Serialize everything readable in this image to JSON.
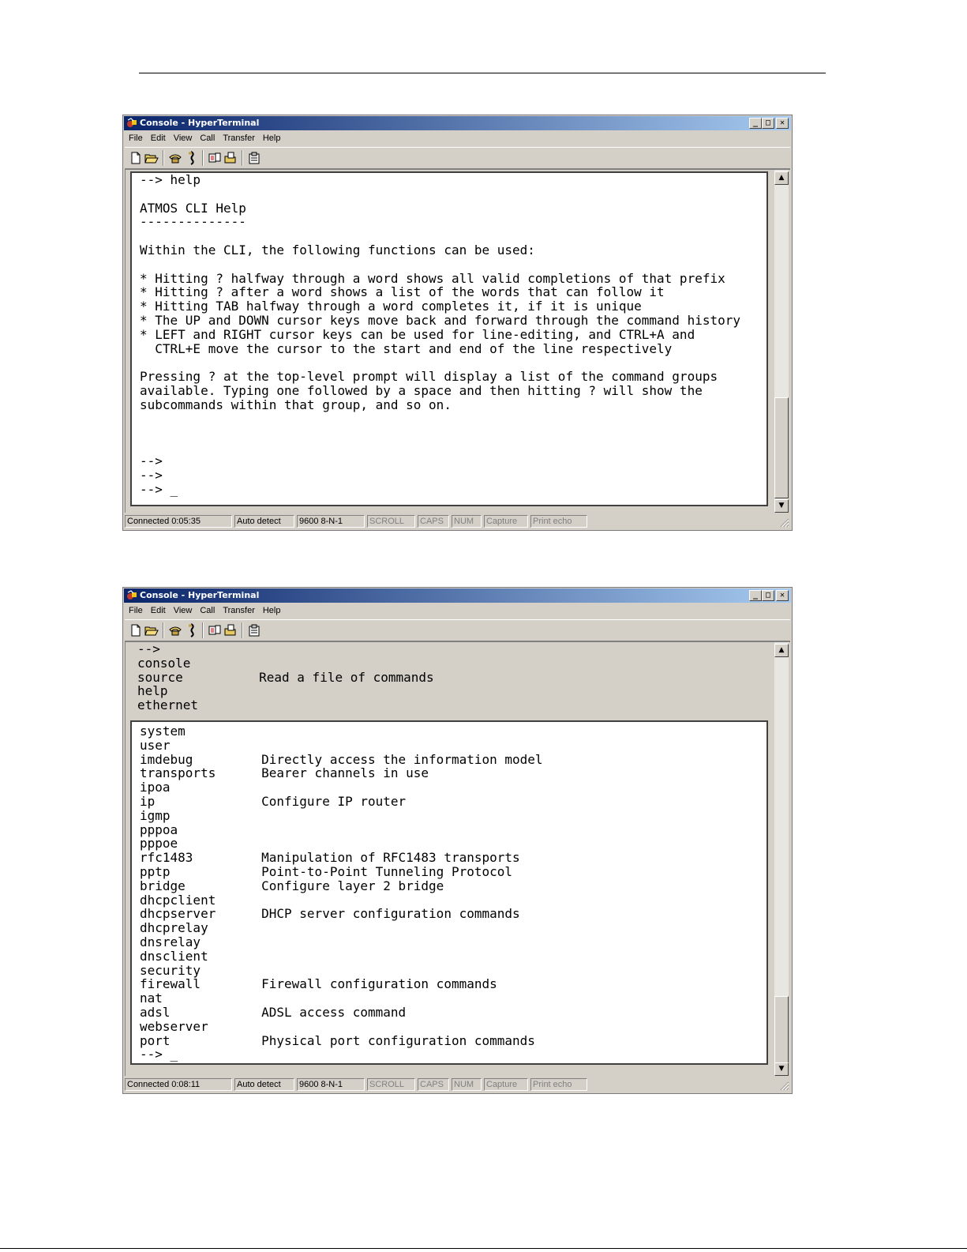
{
  "windows": [
    {
      "title": "Console - HyperTerminal",
      "menu": [
        "File",
        "Edit",
        "View",
        "Call",
        "Transfer",
        "Help"
      ],
      "toolbar_icons": [
        "new-document-icon",
        "open-folder-icon",
        "phone-connect-icon",
        "phone-disconnect-icon",
        "send-icon",
        "receive-icon",
        "properties-icon"
      ],
      "terminal_lines": [
        "--> help",
        "",
        "ATMOS CLI Help",
        "--------------",
        "",
        "Within the CLI, the following functions can be used:",
        "",
        "* Hitting ? halfway through a word shows all valid completions of that prefix",
        "* Hitting ? after a word shows a list of the words that can follow it",
        "* Hitting TAB halfway through a word completes it, if it is unique",
        "* The UP and DOWN cursor keys move back and forward through the command history",
        "* LEFT and RIGHT cursor keys can be used for line-editing, and CTRL+A and",
        "  CTRL+E move the cursor to the start and end of the line respectively",
        "",
        "Pressing ? at the top-level prompt will display a list of the command groups",
        "available. Typing one followed by a space and then hitting ? will show the",
        "subcommands within that group, and so on.",
        "",
        "",
        "",
        "-->",
        "-->",
        "--> _"
      ],
      "status": {
        "connected": "Connected 0:05:35",
        "detect": "Auto detect",
        "settings": "9600 8-N-1",
        "scroll": "SCROLL",
        "caps": "CAPS",
        "num": "NUM",
        "capture": "Capture",
        "print_echo": "Print echo"
      }
    },
    {
      "title": "Console - HyperTerminal",
      "menu": [
        "File",
        "Edit",
        "View",
        "Call",
        "Transfer",
        "Help"
      ],
      "toolbar_icons": [
        "new-document-icon",
        "open-folder-icon",
        "phone-connect-icon",
        "phone-disconnect-icon",
        "send-icon",
        "receive-icon",
        "properties-icon"
      ],
      "scrollback_lines": [
        "-->",
        "console",
        "source          Read a file of commands",
        "help",
        "ethernet"
      ],
      "terminal_lines": [
        "system",
        "user",
        "imdebug         Directly access the information model",
        "transports      Bearer channels in use",
        "ipoa",
        "ip              Configure IP router",
        "igmp",
        "pppoa",
        "pppoe",
        "rfc1483         Manipulation of RFC1483 transports",
        "pptp            Point-to-Point Tunneling Protocol",
        "bridge          Configure layer 2 bridge",
        "dhcpclient",
        "dhcpserver      DHCP server configuration commands",
        "dhcprelay",
        "dnsrelay",
        "dnsclient",
        "security",
        "firewall        Firewall configuration commands",
        "nat",
        "adsl            ADSL access command",
        "webserver",
        "port            Physical port configuration commands",
        "--> _"
      ],
      "status": {
        "connected": "Connected 0:08:11",
        "detect": "Auto detect",
        "settings": "9600 8-N-1",
        "scroll": "SCROLL",
        "caps": "CAPS",
        "num": "NUM",
        "capture": "Capture",
        "print_echo": "Print echo"
      }
    }
  ]
}
